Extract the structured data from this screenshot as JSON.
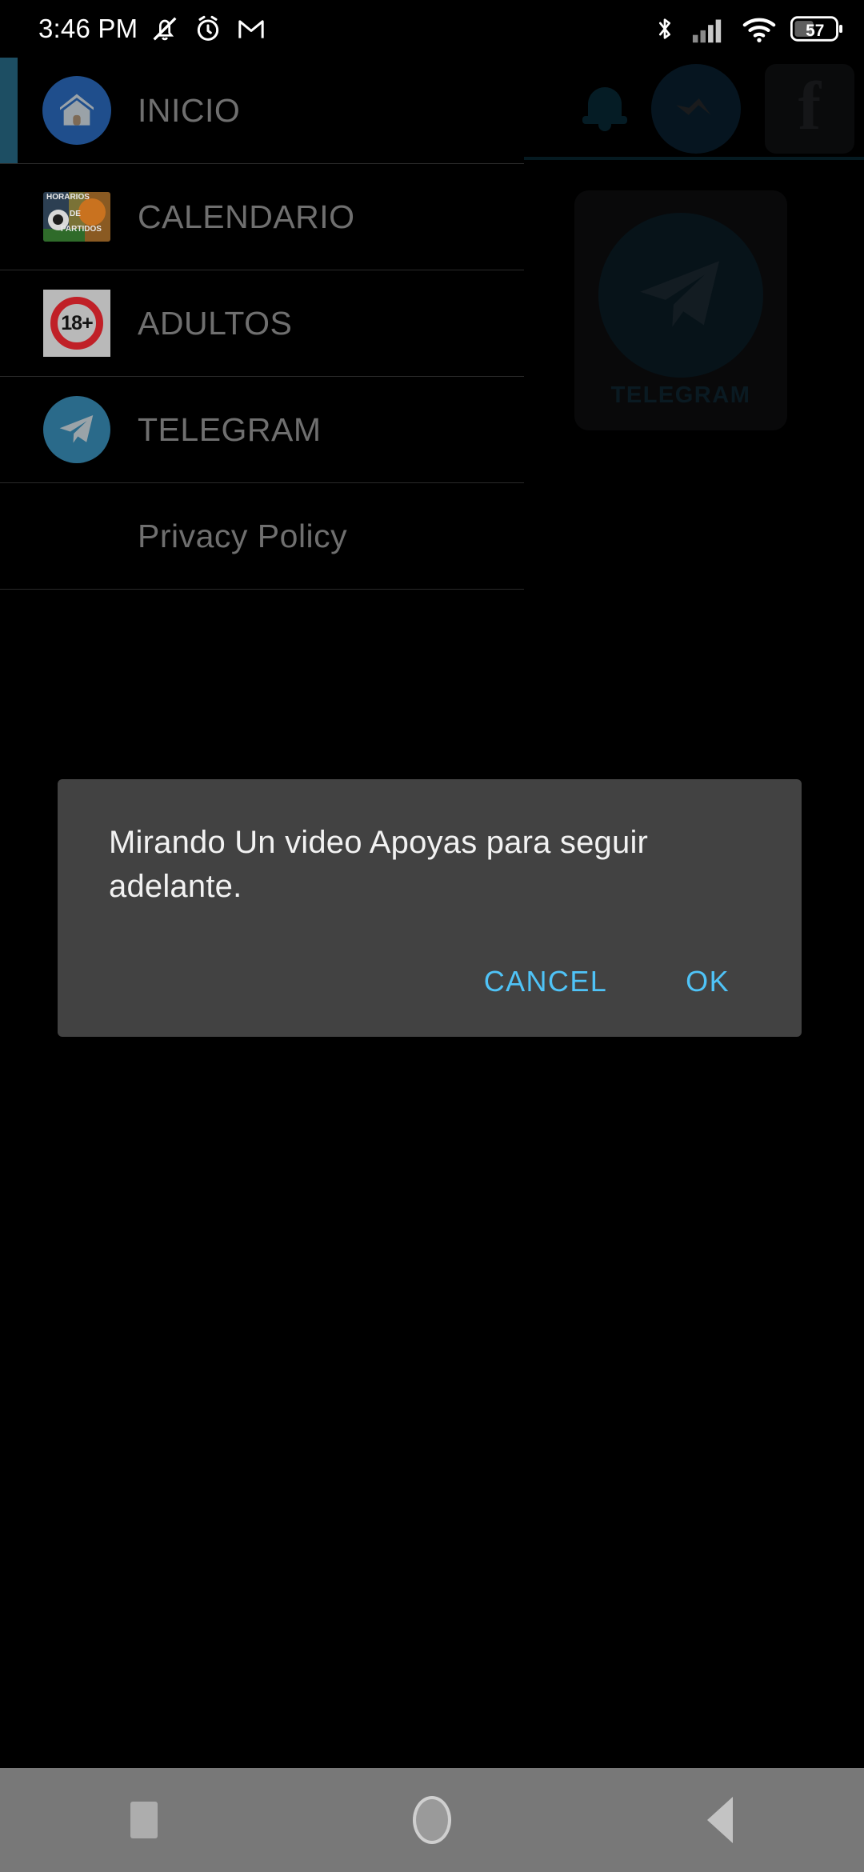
{
  "status_bar": {
    "time": "3:46 PM",
    "left_icons": [
      "silent-mode-icon",
      "alarm-icon",
      "gmail-icon"
    ],
    "right_icons": [
      "bluetooth-icon",
      "cellular-signal-icon",
      "wifi-icon"
    ],
    "battery_percent": "57"
  },
  "background": {
    "toolbar_icons": [
      "notification-bell-icon",
      "messenger-icon",
      "facebook-icon"
    ],
    "facebook_glyph": "f",
    "card": {
      "label": "TELEGRAM",
      "icon": "telegram-icon"
    },
    "divider_color": "#0d3a4a"
  },
  "drawer": {
    "accent_color": "#1d4e63",
    "items": [
      {
        "label": "INICIO",
        "icon": "home-icon",
        "selected": true
      },
      {
        "label": "CALENDARIO",
        "icon": "match-schedule-icon",
        "selected": false,
        "icon_text": {
          "line1": "HORARIOS",
          "line2": "DE",
          "line3": "PARTIDOS"
        }
      },
      {
        "label": "ADULTOS",
        "icon": "adults-18-plus-icon",
        "selected": false,
        "icon_text": "18+"
      },
      {
        "label": "TELEGRAM",
        "icon": "telegram-icon",
        "selected": false
      },
      {
        "label": "Privacy Policy",
        "icon": null,
        "selected": false
      }
    ]
  },
  "dialog": {
    "message": "Mirando Un video Apoyas para seguir adelante.",
    "cancel_label": "CANCEL",
    "ok_label": "OK",
    "accent_color": "#4fc3f7",
    "background_color": "#424242"
  },
  "nav_bar": {
    "recents_label": "recents-button",
    "home_label": "home-button",
    "back_label": "back-button"
  }
}
